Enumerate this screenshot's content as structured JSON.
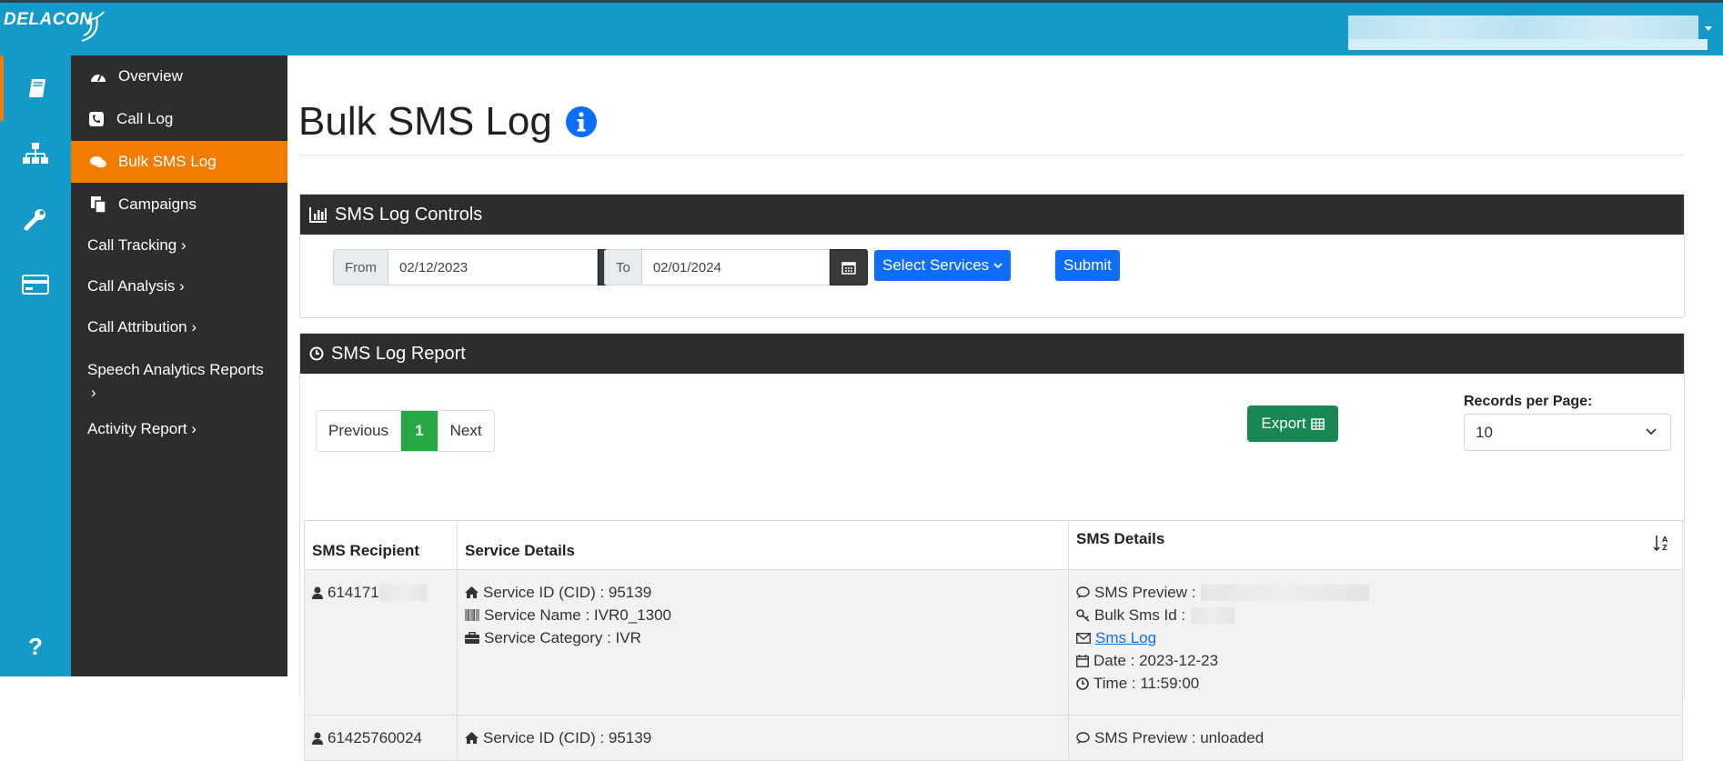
{
  "header": {
    "logo_text": "DELACON"
  },
  "sidebar": {
    "items": [
      {
        "label": "Overview"
      },
      {
        "label": "Call Log"
      },
      {
        "label": "Bulk SMS Log"
      },
      {
        "label": "Campaigns"
      },
      {
        "label": "Call Tracking ›"
      },
      {
        "label": "Call Analysis ›"
      },
      {
        "label": "Call Attribution ›"
      },
      {
        "label": "Speech Analytics Reports"
      },
      {
        "label": "›"
      },
      {
        "label": "Activity Report ›"
      }
    ],
    "help_label": "?"
  },
  "page": {
    "title": "Bulk SMS Log"
  },
  "controls": {
    "title": "SMS Log Controls",
    "from_label": "From",
    "from_value": "02/12/2023",
    "to_label": "To",
    "to_value": "02/01/2024",
    "select_services_label": "Select Services",
    "submit_label": "Submit"
  },
  "report": {
    "title": "SMS Log Report",
    "pager": {
      "previous": "Previous",
      "current": "1",
      "next": "Next"
    },
    "export_label": "Export",
    "records_label": "Records per Page:",
    "records_value": "10",
    "columns": [
      "SMS Recipient",
      "Service Details",
      "SMS Details"
    ],
    "rows": [
      {
        "recipient": "614171",
        "service_id": "Service ID (CID) : 95139",
        "service_name": "Service Name : IVR0_1300",
        "service_category": "Service Category : IVR",
        "sms_preview": "SMS Preview :",
        "bulk_sms_id": "Bulk Sms Id :",
        "sms_log_link": "Sms Log",
        "date": "Date : 2023-12-23",
        "time": "Time : 11:59:00"
      },
      {
        "recipient": "61425760024",
        "service_id": "Service ID (CID) : 95139",
        "sms_preview": "SMS Preview : unloaded"
      }
    ]
  },
  "colors": {
    "brand": "#149ac9",
    "accent": "#f07d00",
    "dark": "#2d2d2d",
    "primary": "#0d6efd",
    "success": "#198754"
  }
}
